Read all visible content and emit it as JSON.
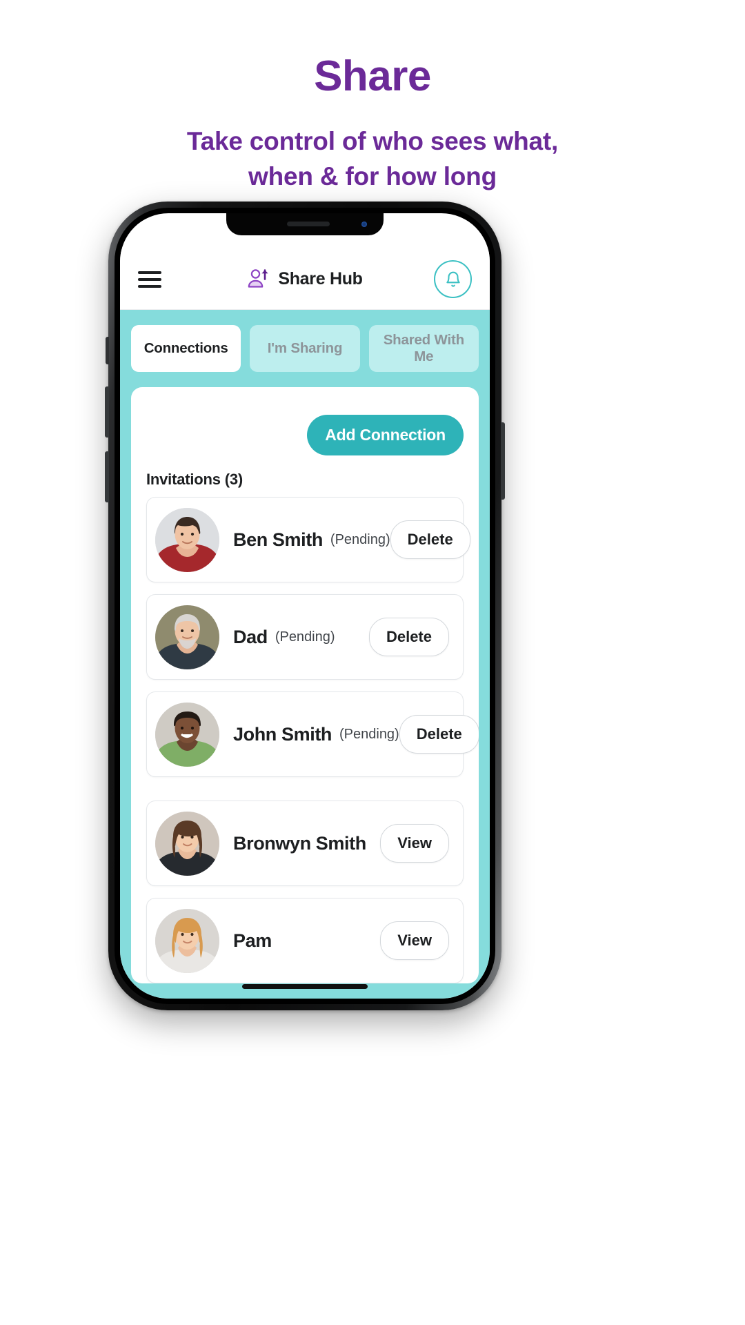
{
  "promo": {
    "title": "Share",
    "subtitle_line1": "Take control of who sees what,",
    "subtitle_line2": "when & for how long",
    "accent_color": "#6B2A98"
  },
  "app": {
    "header": {
      "menu_icon": "hamburger-menu-icon",
      "brand_icon": "person-share-up-arrow-icon",
      "title": "Share Hub",
      "notification_icon": "bell-icon",
      "notification_accent": "#3bc0c3"
    },
    "tabs": [
      {
        "label": "Connections",
        "active": true
      },
      {
        "label": "I'm Sharing",
        "active": false
      },
      {
        "label": "Shared With Me",
        "active": false
      }
    ],
    "add_connection_label": "Add Connection",
    "add_connection_color": "#2eb3b8",
    "invitations_label": "Invitations (3)",
    "band_color": "#85dcdc",
    "invitations": [
      {
        "name": "Ben Smith",
        "status": "(Pending)",
        "action": "Delete",
        "avatar": "avatar-ben-smith"
      },
      {
        "name": "Dad",
        "status": "(Pending)",
        "action": "Delete",
        "avatar": "avatar-dad"
      },
      {
        "name": "John Smith",
        "status": "(Pending)",
        "action": "Delete",
        "avatar": "avatar-john-smith"
      }
    ],
    "connections": [
      {
        "name": "Bronwyn Smith",
        "status": "",
        "action": "View",
        "avatar": "avatar-bronwyn-smith"
      },
      {
        "name": "Pam",
        "status": "",
        "action": "View",
        "avatar": "avatar-pam"
      }
    ]
  }
}
